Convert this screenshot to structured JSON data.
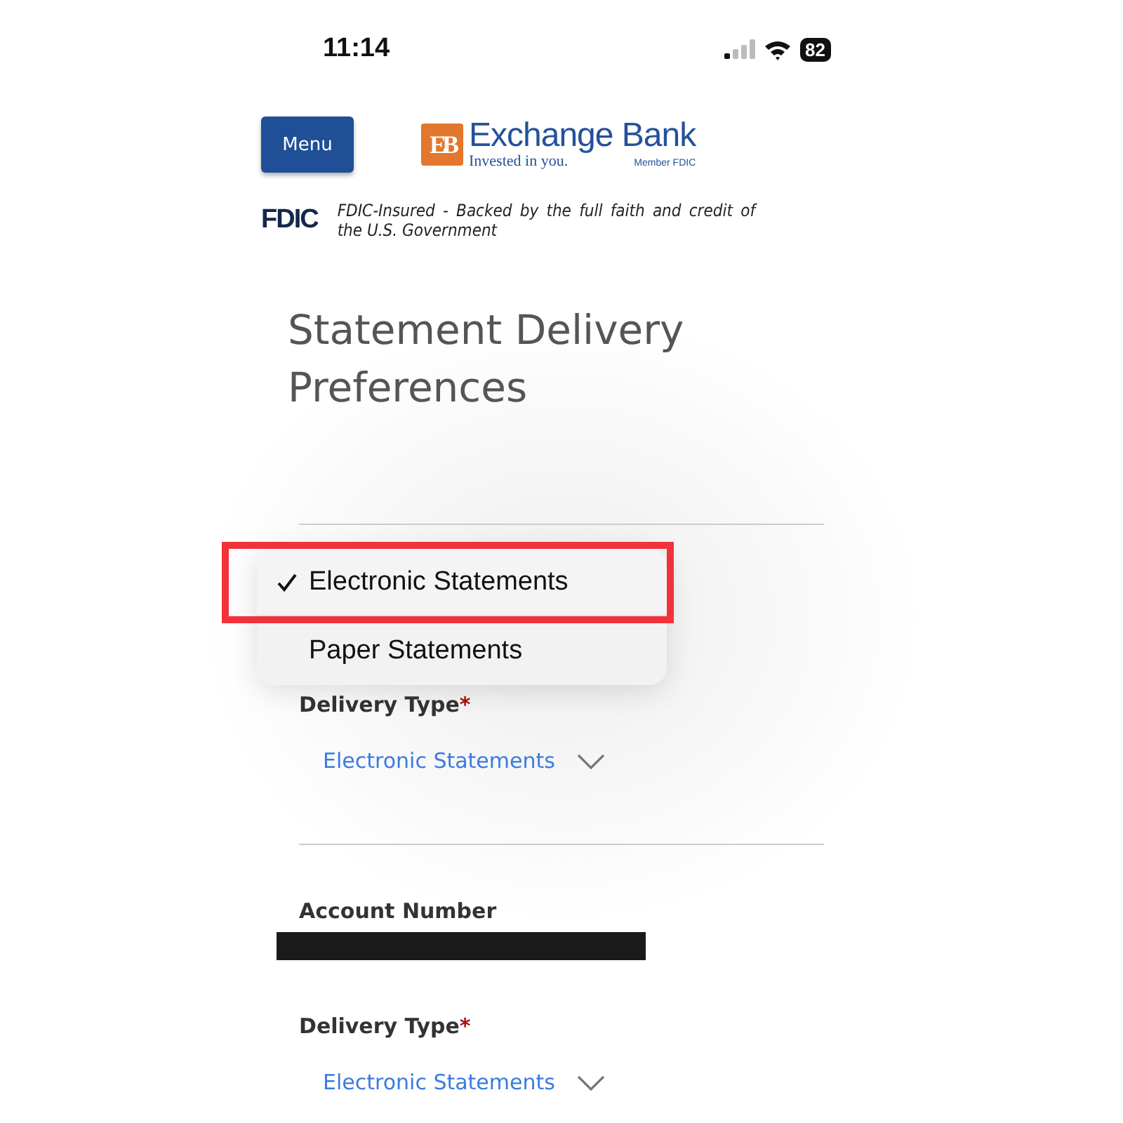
{
  "status_bar": {
    "time": "11:14",
    "battery": "82"
  },
  "header": {
    "menu_button": "Menu",
    "logo": {
      "mark_letters": "EB",
      "name": "Exchange Bank",
      "tagline": "Invested in you.",
      "member": "Member FDIC"
    }
  },
  "fdic": {
    "logo": "FDIC",
    "text": "FDIC-Insured - Backed by the full faith and credit of the U.S. Government"
  },
  "title": "Statement Delivery Preferences",
  "dropdown_menu": {
    "highlighted": true,
    "options": [
      {
        "label": "Electronic Statements",
        "selected": true
      },
      {
        "label": "Paper Statements",
        "selected": false
      }
    ]
  },
  "fields": [
    {
      "kind": "select",
      "label": "Delivery Type",
      "required": true,
      "required_mark": "*",
      "value": "Electronic Statements"
    },
    {
      "kind": "redacted",
      "label": "Account Number"
    },
    {
      "kind": "select",
      "label": "Delivery Type",
      "required": true,
      "required_mark": "*",
      "value": "Electronic Statements"
    }
  ]
}
